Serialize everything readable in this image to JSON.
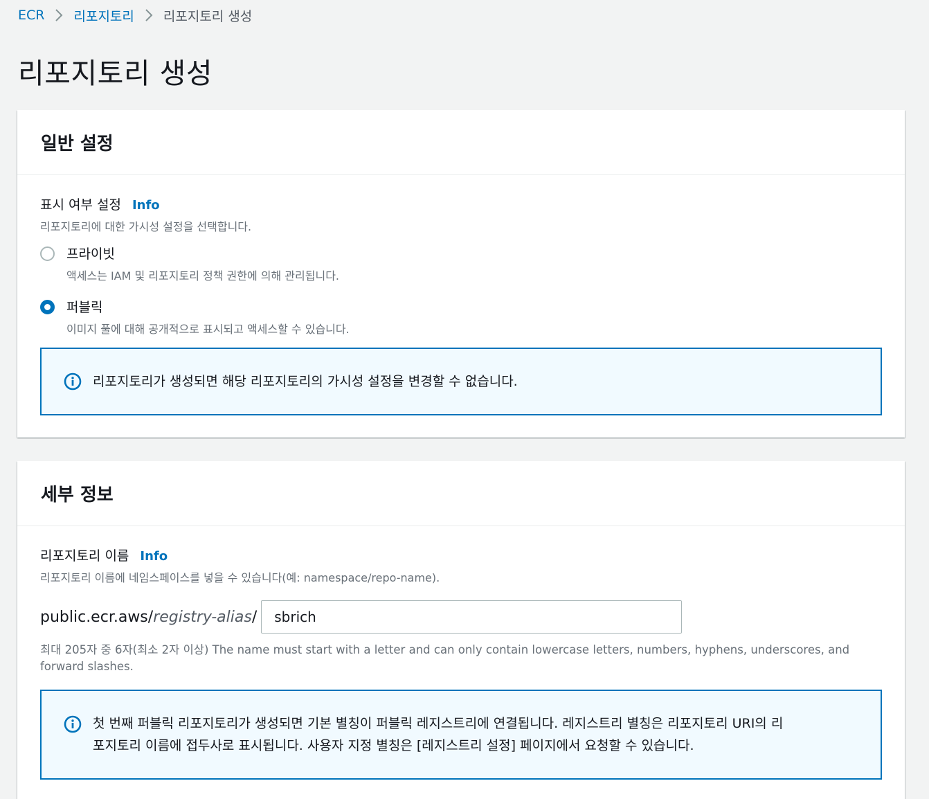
{
  "breadcrumb": {
    "items": [
      {
        "label": "ECR"
      },
      {
        "label": "리포지토리"
      },
      {
        "label": "리포지토리 생성"
      }
    ]
  },
  "page_title": "리포지토리 생성",
  "general_settings": {
    "title": "일반 설정",
    "visibility_label": "표시 여부 설정",
    "info_link": "Info",
    "visibility_desc": "리포지토리에 대한 가시성 설정을 선택합니다.",
    "options": [
      {
        "label": "프라이빗",
        "desc": "액세스는 IAM 및 리포지토리 정책 권한에 의해 관리됩니다.",
        "selected": false
      },
      {
        "label": "퍼블릭",
        "desc": "이미지 풀에 대해 공개적으로 표시되고 액세스할 수 있습니다.",
        "selected": true
      }
    ],
    "alert_text": "리포지토리가 생성되면 해당 리포지토리의 가시성 설정을 변경할 수 없습니다."
  },
  "details": {
    "title": "세부 정보",
    "repo_name_label": "리포지토리 이름",
    "info_link": "Info",
    "repo_name_desc": "리포지토리 이름에 네임스페이스를 넣을 수 있습니다(예: namespace/repo-name).",
    "prefix_base": "public.ecr.aws/",
    "prefix_alias": "registry-alias",
    "prefix_slash": "/",
    "repo_name_value": "sbrich",
    "constraint_text": "최대 205자 중 6자(최소 2자 이상) The name must start with a letter and can only contain lowercase letters, numbers, hyphens, underscores, and forward slashes.",
    "alert_text_line1": "첫 번째 퍼블릭 리포지토리가 생성되면 기본 별칭이 퍼블릭 레지스트리에 연결됩니다. 레지스트리 별칭은 리포지토리 URI의 리",
    "alert_text_line2": "포지토리 이름에 접두사로 표시됩니다. 사용자 지정 별칭은 [레지스트리 설정] 페이지에서 요청할 수 있습니다."
  },
  "colors": {
    "link": "#0073bb",
    "alert_border": "#0073bb",
    "alert_bg": "#f1faff",
    "page_bg": "#f2f3f3"
  }
}
